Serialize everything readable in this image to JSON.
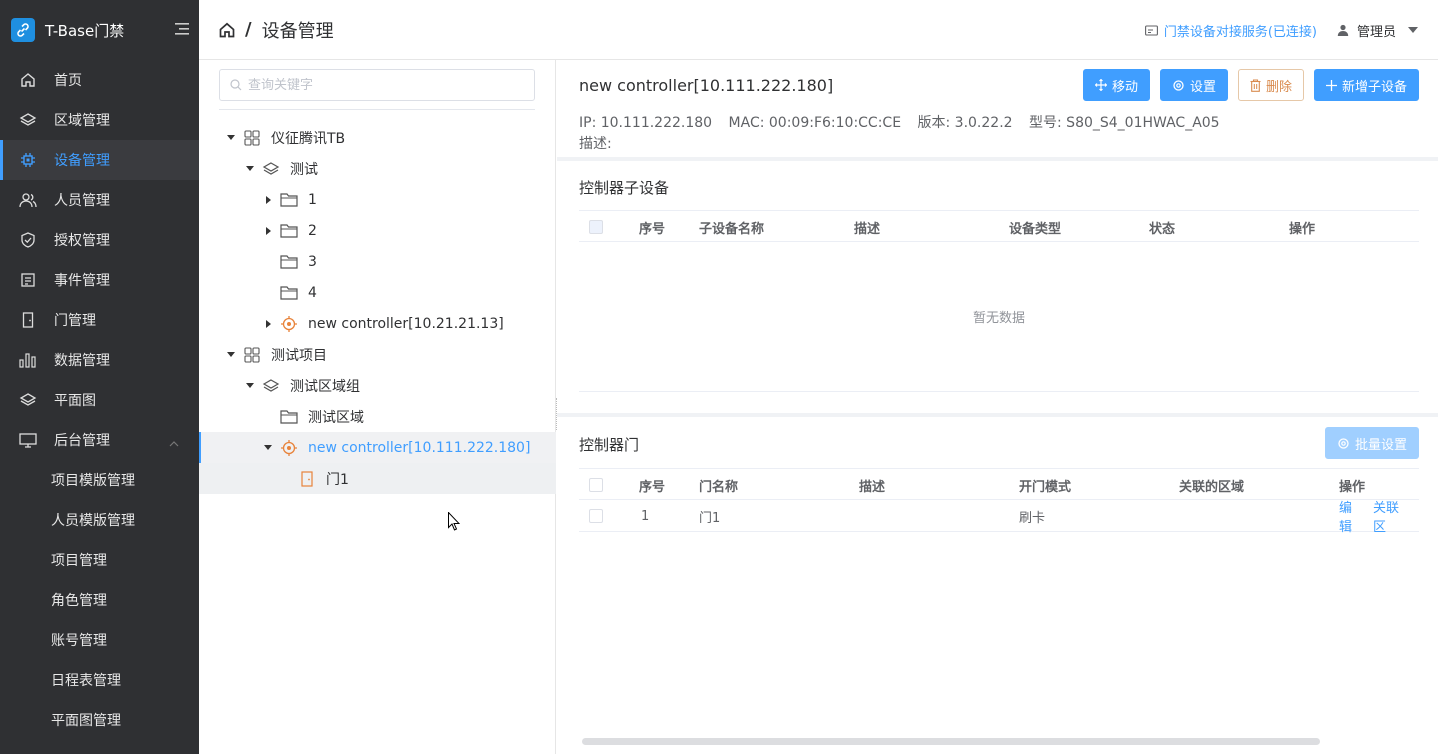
{
  "brand": {
    "title": "T-Base门禁"
  },
  "sidebar": {
    "items": [
      {
        "label": "首页",
        "icon": "home-icon"
      },
      {
        "label": "区域管理",
        "icon": "layers-icon"
      },
      {
        "label": "设备管理",
        "icon": "chip-icon",
        "active": true
      },
      {
        "label": "人员管理",
        "icon": "users-icon"
      },
      {
        "label": "授权管理",
        "icon": "shield-icon"
      },
      {
        "label": "事件管理",
        "icon": "document-icon"
      },
      {
        "label": "门管理",
        "icon": "door-icon"
      },
      {
        "label": "数据管理",
        "icon": "bar-chart-icon"
      },
      {
        "label": "平面图",
        "icon": "layers-icon"
      },
      {
        "label": "后台管理",
        "icon": "monitor-icon",
        "expanded": true
      }
    ],
    "subitems": [
      {
        "label": "项目模版管理"
      },
      {
        "label": "人员模版管理"
      },
      {
        "label": "项目管理"
      },
      {
        "label": "角色管理"
      },
      {
        "label": "账号管理"
      },
      {
        "label": "日程表管理"
      },
      {
        "label": "平面图管理"
      }
    ]
  },
  "header": {
    "breadcrumb": "设备管理",
    "service_status": "门禁设备对接服务(已连接)",
    "user": "管理员"
  },
  "tree": {
    "search_placeholder": "查询关键字",
    "nodes": [
      {
        "label": "仪征腾讯TB"
      },
      {
        "label": "测试"
      },
      {
        "label": "1"
      },
      {
        "label": "2"
      },
      {
        "label": "3"
      },
      {
        "label": "4"
      },
      {
        "label": "new controller[10.21.21.13]"
      },
      {
        "label": "测试项目"
      },
      {
        "label": "测试区域组"
      },
      {
        "label": "测试区域"
      },
      {
        "label": "new controller[10.111.222.180]"
      },
      {
        "label": "门1"
      }
    ]
  },
  "controller": {
    "title": "new controller[10.111.222.180]",
    "ip": "IP: 10.111.222.180",
    "mac": "MAC: 00:09:F6:10:CC:CE",
    "version": "版本: 3.0.22.2",
    "model": "型号: S80_S4_01HWAC_A05",
    "desc": "描述:",
    "buttons": {
      "move": "移动",
      "settings": "设置",
      "delete": "删除",
      "add_sub": "新增子设备"
    }
  },
  "subdevices": {
    "title": "控制器子设备",
    "columns": [
      "序号",
      "子设备名称",
      "描述",
      "设备类型",
      "状态",
      "操作"
    ],
    "empty_text": "暂无数据"
  },
  "doors": {
    "title": "控制器门",
    "batch_button": "批量设置",
    "columns": [
      "序号",
      "门名称",
      "描述",
      "开门模式",
      "关联的区域",
      "操作"
    ],
    "rows": [
      {
        "index": "1",
        "name": "门1",
        "desc": "",
        "mode": "刷卡",
        "area": "",
        "edit": "编辑",
        "link_area": "关联区"
      }
    ]
  },
  "colors": {
    "primary": "#409eff",
    "sidebar_bg": "#2f3033",
    "danger": "#d98a4d",
    "device_orange": "#e8833a"
  }
}
